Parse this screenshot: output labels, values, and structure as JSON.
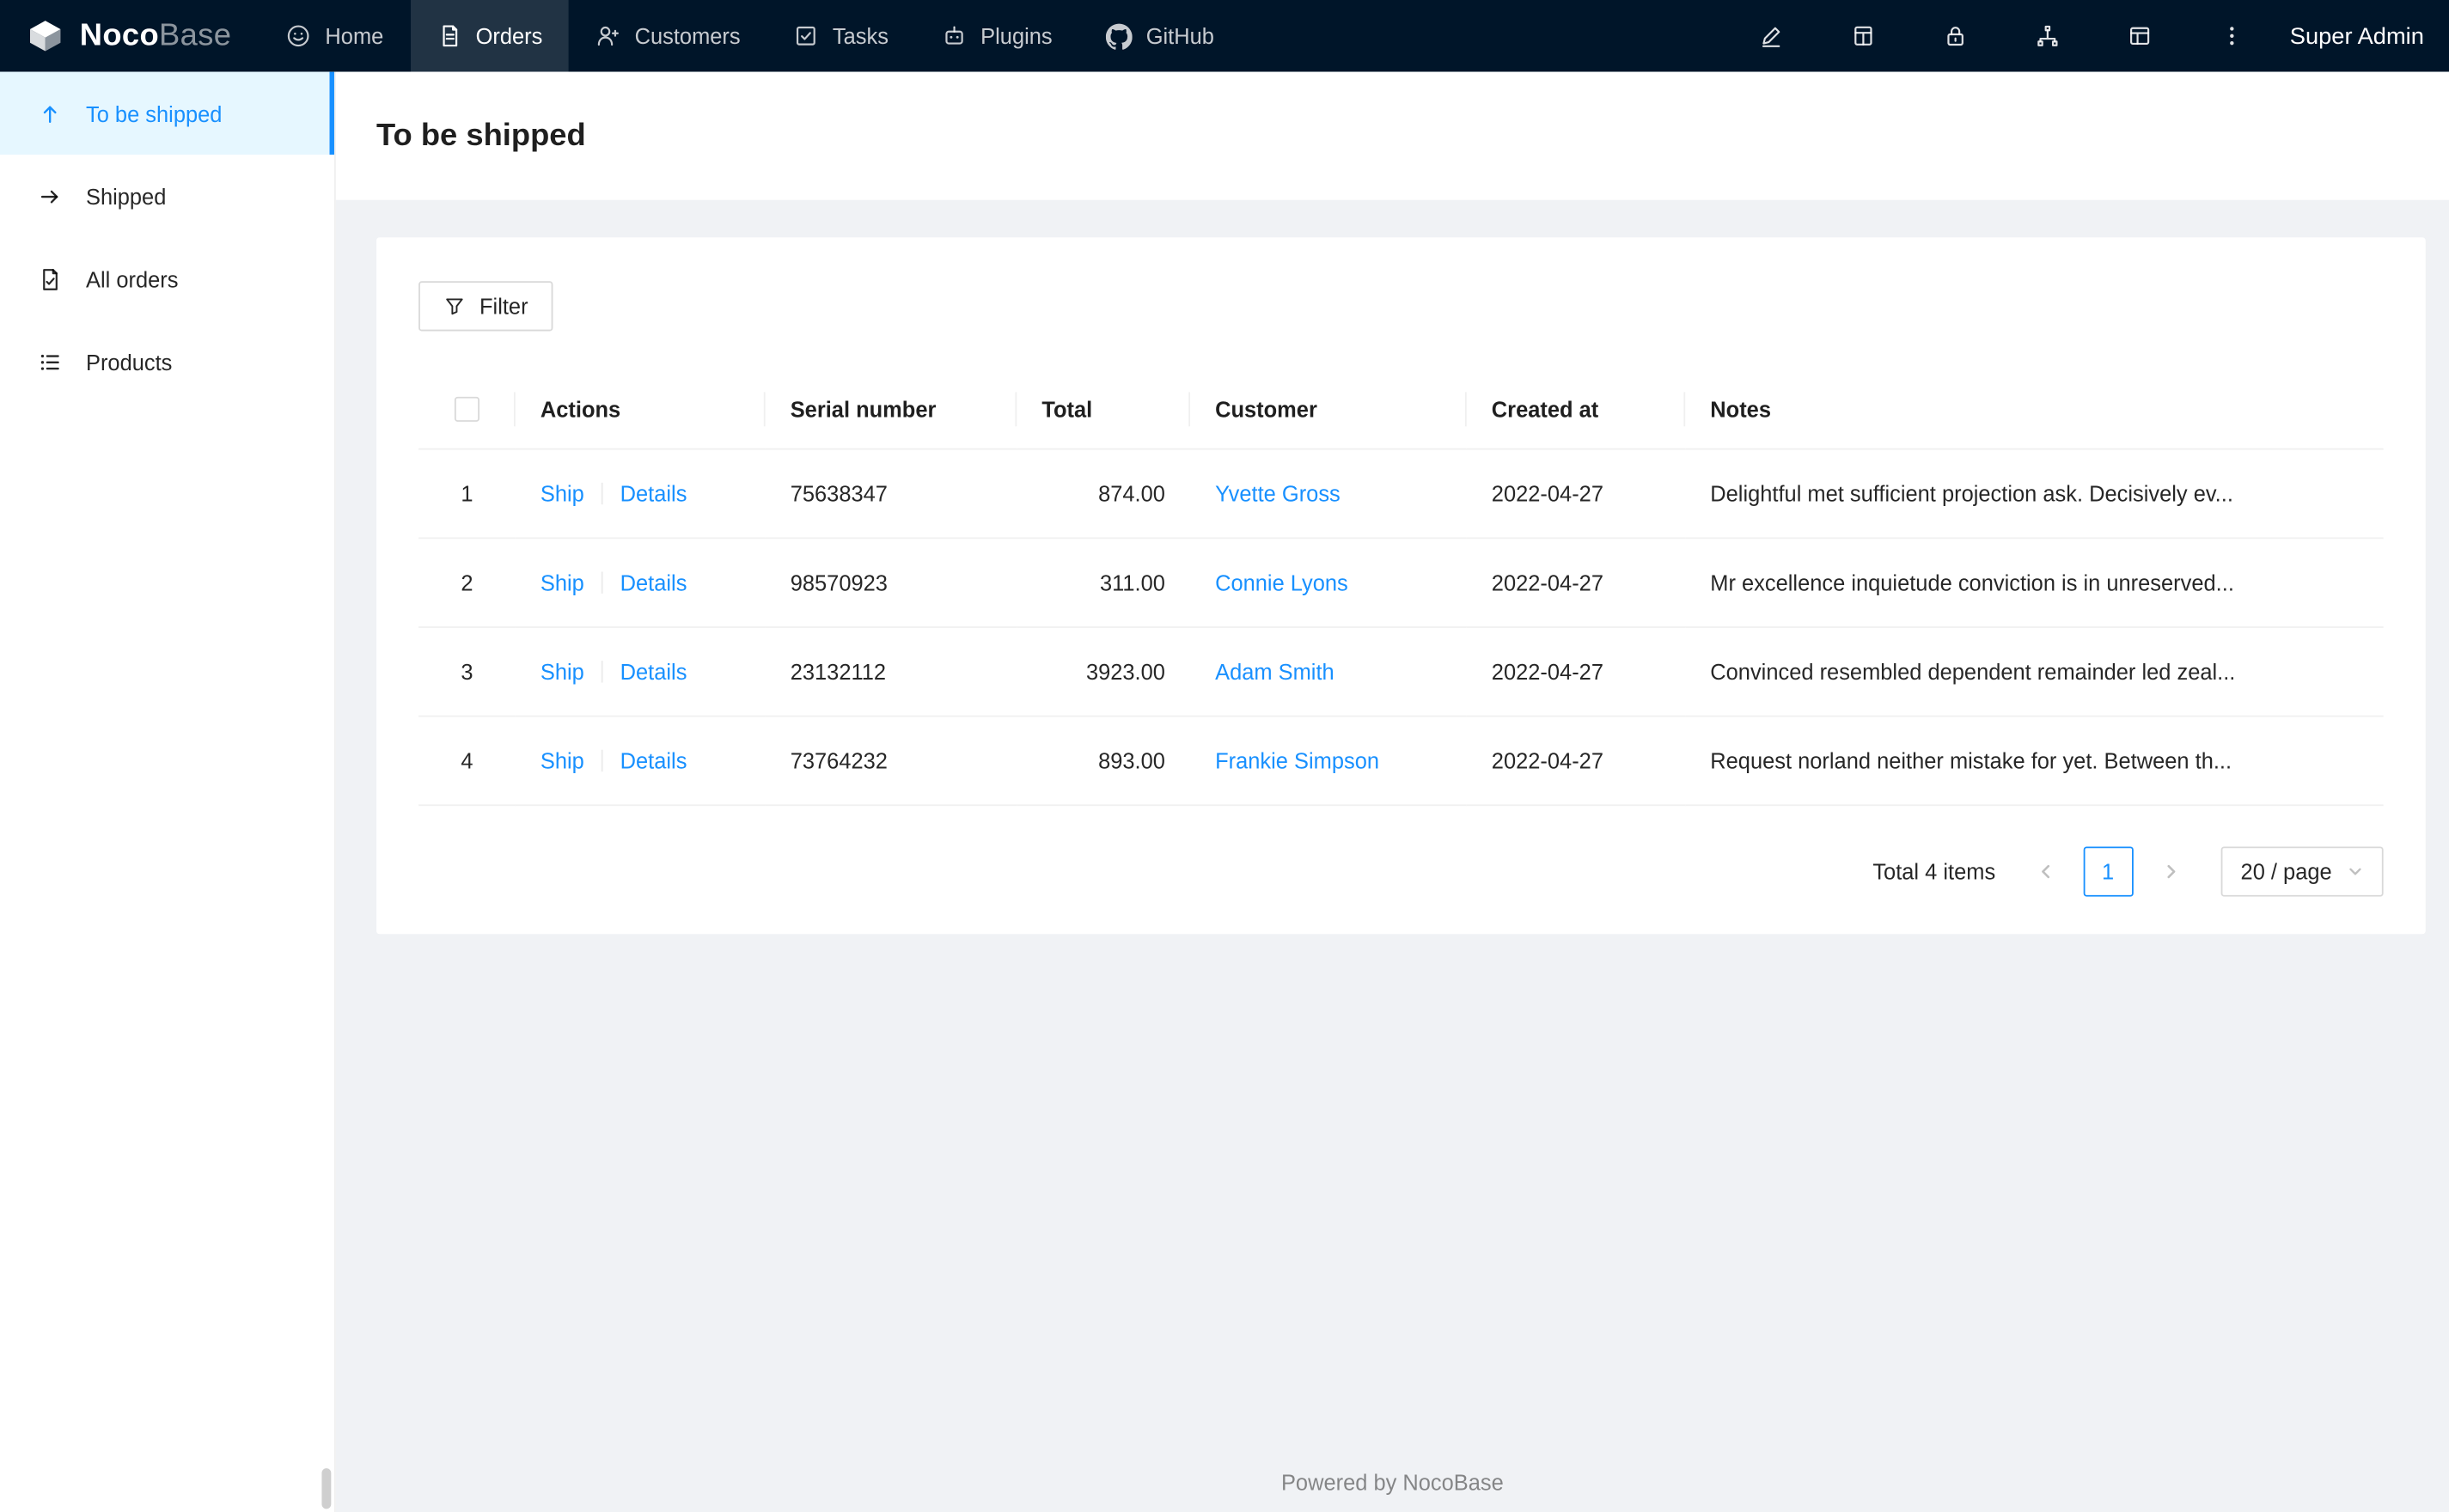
{
  "navbar": {
    "logo": {
      "bold": "Noco",
      "light": "Base"
    },
    "items": [
      {
        "label": "Home",
        "icon": "home-icon",
        "active": false
      },
      {
        "label": "Orders",
        "icon": "orders-icon",
        "active": true
      },
      {
        "label": "Customers",
        "icon": "customers-icon",
        "active": false
      },
      {
        "label": "Tasks",
        "icon": "tasks-icon",
        "active": false
      },
      {
        "label": "Plugins",
        "icon": "plugins-icon",
        "active": false
      },
      {
        "label": "GitHub",
        "icon": "github-icon",
        "active": false
      }
    ],
    "right_icons": [
      "highlighter-icon",
      "table-icon",
      "lock-icon",
      "share-nodes-icon",
      "layout-icon",
      "more-icon"
    ],
    "user": "Super Admin"
  },
  "sidebar": {
    "items": [
      {
        "label": "To be shipped",
        "icon": "arrow-up-icon",
        "active": true
      },
      {
        "label": "Shipped",
        "icon": "arrow-right-icon",
        "active": false
      },
      {
        "label": "All orders",
        "icon": "orders-file-icon",
        "active": false
      },
      {
        "label": "Products",
        "icon": "list-icon",
        "active": false
      }
    ]
  },
  "page": {
    "title": "To be shipped"
  },
  "toolbar": {
    "filter_label": "Filter"
  },
  "table": {
    "headers": [
      "Actions",
      "Serial number",
      "Total",
      "Customer",
      "Created at",
      "Notes"
    ],
    "action_labels": {
      "ship": "Ship",
      "details": "Details"
    },
    "rows": [
      {
        "index": "1",
        "serial": "75638347",
        "total": "874.00",
        "customer": "Yvette Gross",
        "created_at": "2022-04-27",
        "notes": "Delightful met sufficient projection ask. Decisively ev..."
      },
      {
        "index": "2",
        "serial": "98570923",
        "total": "311.00",
        "customer": "Connie Lyons",
        "created_at": "2022-04-27",
        "notes": "Mr excellence inquietude conviction is in unreserved..."
      },
      {
        "index": "3",
        "serial": "23132112",
        "total": "3923.00",
        "customer": "Adam Smith",
        "created_at": "2022-04-27",
        "notes": "Convinced resembled dependent remainder led zeal..."
      },
      {
        "index": "4",
        "serial": "73764232",
        "total": "893.00",
        "customer": "Frankie Simpson",
        "created_at": "2022-04-27",
        "notes": "Request norland neither mistake for yet. Between th..."
      }
    ]
  },
  "pagination": {
    "total_text": "Total 4 items",
    "current_page": "1",
    "page_size": "20 / page"
  },
  "footer": {
    "text": "Powered by NocoBase"
  },
  "colors": {
    "accent": "#1890ff",
    "navbar_bg": "#001529",
    "active_item_bg": "#e6f7ff",
    "content_bg": "#f0f2f5"
  }
}
